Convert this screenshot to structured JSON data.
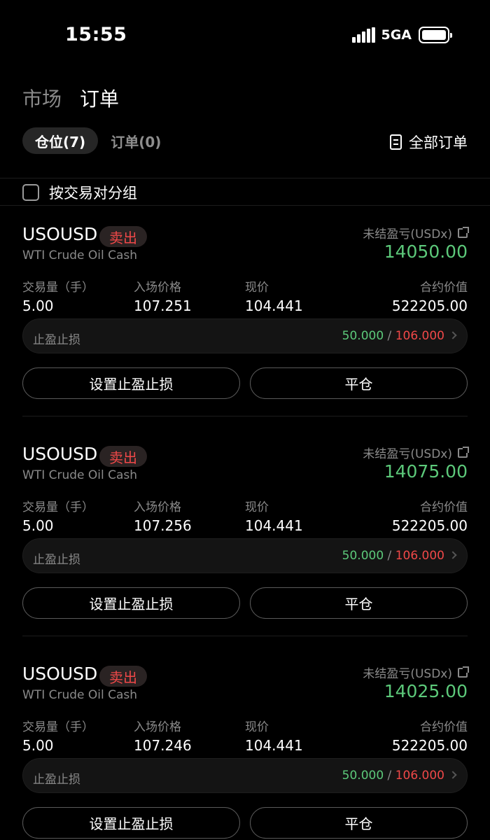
{
  "status_bar": {
    "time": "15:55",
    "network": "5GA"
  },
  "top_nav": {
    "tabs": [
      "市场",
      "订单"
    ],
    "active": 1
  },
  "sub_tabs": {
    "positions": "仓位(7)",
    "orders": "订单(0)"
  },
  "all_orders_label": "全部订单",
  "group_toggle_label": "按交易对分组",
  "labels": {
    "volume": "交易量（手）",
    "entry_price": "入场价格",
    "current_price": "现价",
    "contract_value": "合约价值",
    "unrealized_pnl": "未结盈亏(USDx)",
    "tp_sl": "止盈止损",
    "set_tp_sl": "设置止盈止损",
    "close": "平仓",
    "separator": "/"
  },
  "colors": {
    "profit": "#5cc97a",
    "loss": "#f04848",
    "background": "#000000"
  },
  "positions": [
    {
      "symbol": "USOUSD",
      "side": "卖出",
      "description": "WTI Crude Oil Cash",
      "pnl": "14050.00",
      "volume": "5.00",
      "entry_price": "107.251",
      "current_price": "104.441",
      "contract_value": "522205.00",
      "take_profit": "50.000",
      "stop_loss": "106.000"
    },
    {
      "symbol": "USOUSD",
      "side": "卖出",
      "description": "WTI Crude Oil Cash",
      "pnl": "14075.00",
      "volume": "5.00",
      "entry_price": "107.256",
      "current_price": "104.441",
      "contract_value": "522205.00",
      "take_profit": "50.000",
      "stop_loss": "106.000"
    },
    {
      "symbol": "USOUSD",
      "side": "卖出",
      "description": "WTI Crude Oil Cash",
      "pnl": "14025.00",
      "volume": "5.00",
      "entry_price": "107.246",
      "current_price": "104.441",
      "contract_value": "522205.00",
      "take_profit": "50.000",
      "stop_loss": "106.000"
    }
  ]
}
